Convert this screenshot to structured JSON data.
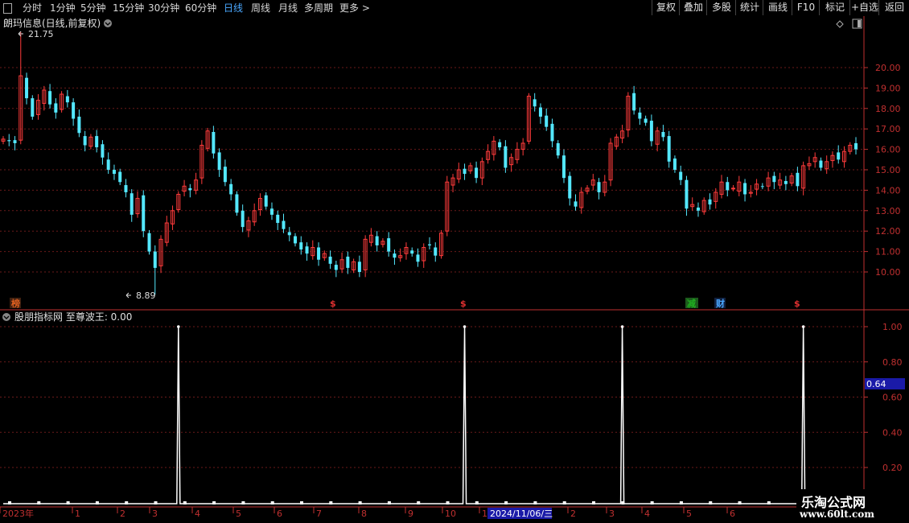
{
  "toolbar": {
    "periods": [
      "分时",
      "1分钟",
      "5分钟",
      "15分钟",
      "30分钟",
      "60分钟",
      "日线",
      "周线",
      "月线",
      "多周期",
      "更多 >"
    ],
    "active_period": "日线",
    "buttons": [
      "复权",
      "叠加",
      "多股",
      "统计",
      "画线",
      "F10",
      "标记",
      "+自选",
      "返回"
    ]
  },
  "main_panel": {
    "title": "朗玛信息(日线,前复权)",
    "high_marker": "21.75",
    "low_marker": "8.89",
    "y_ticks": [
      "20.00",
      "19.00",
      "18.00",
      "17.00",
      "16.00",
      "15.00",
      "14.00",
      "13.00",
      "12.00",
      "11.00",
      "10.00"
    ],
    "event_tags": [
      {
        "text": "榜",
        "color": "#e06020"
      },
      {
        "text": "$",
        "color": "#e03030"
      },
      {
        "text": "$",
        "color": "#e03030"
      },
      {
        "text": "减",
        "color": "#20b020"
      },
      {
        "text": "财",
        "color": "#4aa8ff"
      },
      {
        "text": "$",
        "color": "#e03030"
      }
    ]
  },
  "indicator_panel": {
    "title": "股朋指标网 至尊波王: 0.00",
    "y_ticks": [
      "1.00",
      "0.80",
      "0.60",
      "0.40",
      "0.20"
    ],
    "cursor_value": "0.64"
  },
  "date_axis": {
    "labels": [
      "2023年",
      "1",
      "2",
      "3",
      "4",
      "5",
      "6",
      "7",
      "8",
      "9",
      "10",
      "1",
      "2",
      "3",
      "4",
      "5",
      "6"
    ],
    "highlighted_date": "2024/11/06/三"
  },
  "watermark": {
    "line1": "乐淘公式网",
    "line2": "www.60lt.com"
  },
  "colors": {
    "up": "#ff3b3b",
    "down": "#54e8ff",
    "grid": "#6b1a1a",
    "axis": "#c03030",
    "accent": "#4aa8ff"
  },
  "chart_data": {
    "type": "candlestick",
    "close_prices": [
      16.5,
      16.4,
      16.3,
      19.6,
      18.5,
      17.6,
      18.4,
      18.9,
      18.2,
      17.8,
      18.7,
      18.3,
      17.5,
      16.8,
      16.2,
      16.6,
      16.1,
      15.6,
      15.0,
      14.8,
      14.4,
      13.9,
      12.8,
      13.6,
      12.0,
      11.0,
      10.2,
      11.6,
      12.4,
      13.0,
      13.8,
      14.2,
      14.0,
      14.5,
      16.2,
      16.9,
      15.8,
      15.0,
      14.4,
      13.8,
      12.9,
      12.2,
      12.5,
      13.0,
      13.6,
      13.2,
      12.8,
      12.4,
      12.1,
      11.8,
      11.4,
      11.1,
      10.9,
      11.2,
      10.6,
      10.9,
      10.4,
      10.1,
      10.6,
      10.2,
      10.5,
      10.0,
      11.6,
      11.8,
      11.3,
      11.5,
      11.0,
      10.7,
      10.8,
      11.2,
      10.9,
      10.5,
      11.2,
      11.3,
      10.8,
      11.9,
      14.4,
      14.6,
      15.0,
      14.8,
      15.2,
      14.6,
      15.4,
      15.9,
      16.4,
      16.1,
      15.1,
      15.6,
      16.0,
      16.3,
      18.6,
      18.1,
      17.6,
      17.1,
      16.4,
      15.7,
      14.6,
      13.6,
      13.2,
      13.9,
      14.1,
      14.5,
      13.9,
      14.4,
      16.3,
      16.6,
      16.9,
      18.6,
      17.9,
      17.5,
      17.3,
      16.4,
      16.9,
      16.6,
      15.4,
      15.0,
      14.5,
      13.1,
      13.3,
      13.0,
      13.5,
      13.3,
      13.9,
      14.4,
      14.0,
      14.1,
      14.4,
      13.8,
      13.9,
      14.3,
      14.2,
      14.6,
      14.4,
      14.5,
      14.3,
      14.7,
      14.2,
      15.2,
      15.3,
      15.6,
      15.1,
      15.4,
      15.7,
      15.5,
      15.9,
      16.2,
      16.0
    ],
    "high_value": 21.75,
    "low_value": 8.89,
    "ylim": [
      9.0,
      21.0
    ],
    "indicator": {
      "name": "至尊波王",
      "spike_indices": [
        30,
        79,
        106,
        137
      ],
      "spike_value": 1.0,
      "ylim": [
        0,
        1.0
      ]
    }
  }
}
